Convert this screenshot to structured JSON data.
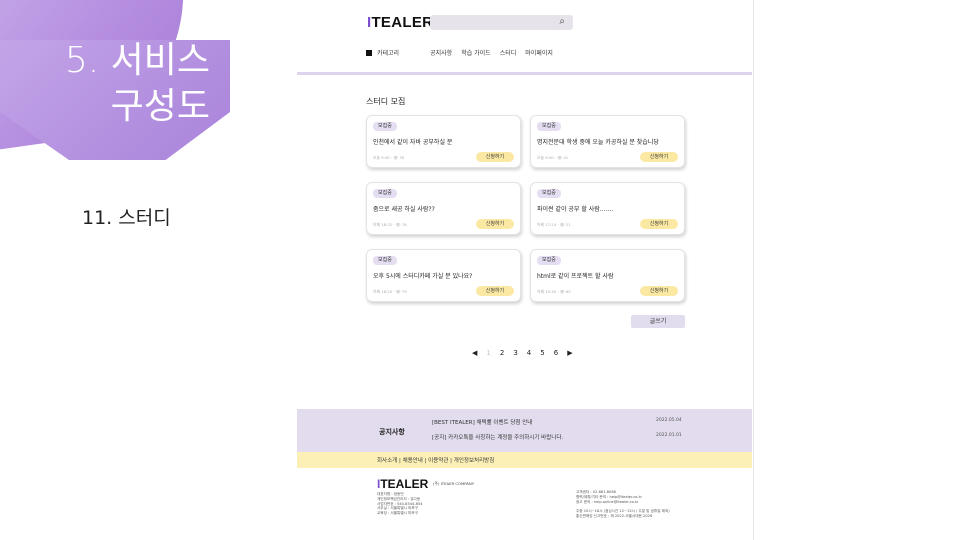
{
  "slide": {
    "title_line1": "5. 서비스",
    "title_line2": "구성도",
    "subtitle": "11. 스터디"
  },
  "colors": {
    "accent": "#7b4fd0",
    "blob": "#b58ee0",
    "badge": "#e5def2",
    "apply": "#fbe9a3",
    "notice_bg": "#e2dcee",
    "links_bg": "#fdf0b7"
  },
  "header": {
    "logo_prefix": "I",
    "logo_text": "TEALER",
    "search_icon": "search-icon",
    "search_symbol": "⌕"
  },
  "nav": {
    "category_label": "카테고리",
    "items": [
      "공지사항",
      "학습 가이드",
      "스터디",
      "마이페이지"
    ]
  },
  "section_title": "스터디 모집",
  "cards": [
    {
      "badge": "모집중",
      "title": "인천에서 같이 자바 공부하실 분",
      "meta": "오늘 9:30 · 👁 30",
      "button": "신청하기"
    },
    {
      "badge": "모집중",
      "title": "명지전문대 학생 중에 오늘 카공하실 분 찾습니당",
      "meta": "오늘 9:30 · 👁 41",
      "button": "신청하기"
    },
    {
      "badge": "모집중",
      "title": "줌으로 새공 하실 사람??",
      "meta": "어제 18:32 · 👁 76",
      "button": "신청하기"
    },
    {
      "badge": "모집중",
      "title": "파이썬 같이 공부 할 사람.......",
      "meta": "어제 17:24 · 👁 21",
      "button": "신청하기"
    },
    {
      "badge": "모집중",
      "title": "오후 5시에 스터디카페 가실 분 있나요?",
      "meta": "어제 16:20 · 👁 79",
      "button": "신청하기"
    },
    {
      "badge": "모집중",
      "title": "html로 같이 프로젝트 할 사람",
      "meta": "어제 15:30 · 👁 60",
      "button": "신청하기"
    }
  ],
  "write_button": "글쓰기",
  "pagination": {
    "prev": "◀",
    "next": "▶",
    "pages": [
      "1",
      "2",
      "3",
      "4",
      "5",
      "6"
    ],
    "current": "1"
  },
  "notice": {
    "label": "공지사항",
    "rows": [
      {
        "text": "[BEST ITEALER] 채택률 이벤트 당첨 안내",
        "date": "2022.05.04"
      },
      {
        "text": "[공지] 카카오톡을 사칭하는 계정을 주의하시기 바랍니다.",
        "date": "2022.01.01"
      }
    ]
  },
  "footer_links": "회사소개 | 채용안내 | 이용약관 | 개인정보처리방침",
  "footer": {
    "logo_prefix": "I",
    "logo_text": "TEALER",
    "company": "(주) ITEAER COMPANY",
    "left_info": [
      "대표자명 : 정동민",
      "개인정보책임관리자 : 유다윤",
      "사업자번호 : 540-8544-854",
      "사무실 : 서울특별시 마포구",
      "교육장 : 서울특별시 마포구"
    ],
    "right_info": [
      "고객센터 : 02-681-8086",
      "협력/제휴/기타 문의 : help@itealer.co.kr",
      "광고 문의 : help.online@itealer.co.kr",
      "",
      "주중 10시~18시 (점심시간 12~13시 / 주말 및 공휴일 제외)",
      "통신판매업 신고번호 : 제 2022-서울서대문-2026"
    ]
  }
}
